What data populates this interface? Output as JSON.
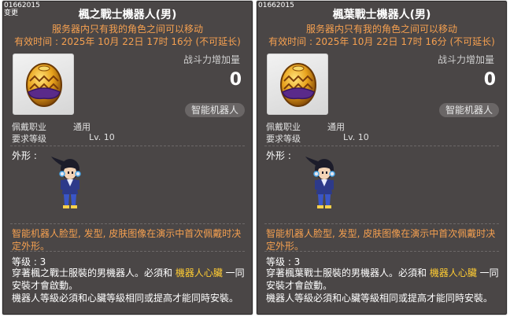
{
  "panels": [
    {
      "item_id": "01662015",
      "change_label": "变更",
      "title": "楓之戰士機器人(男)",
      "subtitle": "服务器内只有我的角色之间可以移动",
      "expiry": "有效时间 : 2025年 10月 22日 17时 16分 (不可延长)",
      "power_label": "战斗力增加量",
      "power_value": "0",
      "tag": "智能机器人",
      "job_label": "佩戴职业",
      "job_value": "通用",
      "level_label": "要求等级",
      "level_value": "Lv. 10",
      "shape_label": "外形 :",
      "desc": "智能机器人脸型, 发型, 皮肤图像在演示中首次佩戴时决定外形。",
      "grade": "等级 : 3",
      "body_pre": "穿著楓之戰士服裝的男機器人。必須和 ",
      "body_hl": "機器人心臟",
      "body_post": " 一同安裝才會啟動。",
      "body_line2": "機器人等級必須和心臟等級相同或提高才能同時安裝。"
    },
    {
      "item_id": "01662015",
      "title": "楓葉戰士機器人(男)",
      "subtitle": "服务器内只有我的角色之间可以移动",
      "expiry": "有效时间 : 2025年 10月 22日 17时 16分 (不可延长)",
      "power_label": "战斗力增加量",
      "power_value": "0",
      "tag": "智能机器人",
      "job_label": "佩戴职业",
      "job_value": "通用",
      "level_label": "要求等级",
      "level_value": "Lv. 10",
      "shape_label": "外形 :",
      "desc": "智能机器人脸型, 发型, 皮肤图像在演示中首次佩戴时决定外形。",
      "grade": "等级 : 3",
      "body_pre": "穿著楓葉戰士服裝的男機器人。必須和 ",
      "body_hl": "機器人心臟",
      "body_post": " 一同安裝才會啟動。",
      "body_line2": "機器人等級必須和心臟等級相同或提高才能同時安裝。"
    }
  ],
  "icons": {
    "item": "android-heart-egg-icon",
    "character": "android-character-figure"
  },
  "colors": {
    "panel_bg": "#4a4646",
    "accent_orange": "#f5a050",
    "highlight_yellow": "#ffcc33"
  }
}
